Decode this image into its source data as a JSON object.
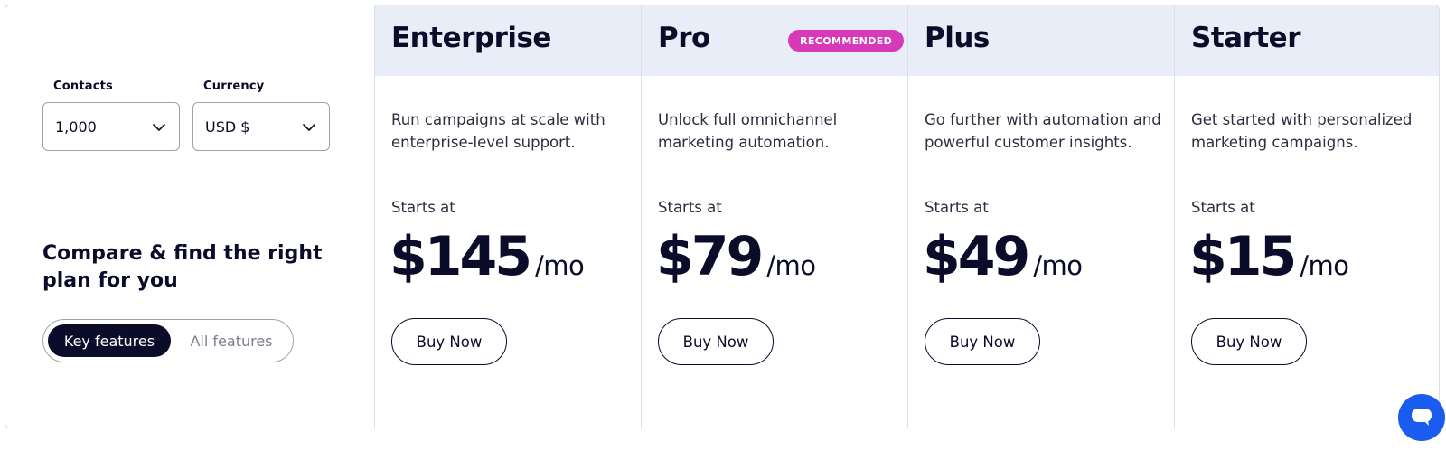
{
  "filters": {
    "contacts_label": "Contacts",
    "contacts_value": "1,000",
    "currency_label": "Currency",
    "currency_value": "USD $"
  },
  "compare": {
    "title": "Compare & find the right plan for you",
    "toggle_active": "Key features",
    "toggle_inactive": "All features"
  },
  "plans": [
    {
      "name": "Enterprise",
      "description": "Run campaigns at scale with enterprise-level support.",
      "starts_label": "Starts at",
      "price": "$145",
      "period": "/mo",
      "button": "Buy Now"
    },
    {
      "name": "Pro",
      "badge": "RECOMMENDED",
      "description": "Unlock full omnichannel marketing automation.",
      "starts_label": "Starts at",
      "price": "$79",
      "period": "/mo",
      "button": "Buy Now"
    },
    {
      "name": "Plus",
      "description": "Go further with automation and powerful customer insights.",
      "starts_label": "Starts at",
      "price": "$49",
      "period": "/mo",
      "button": "Buy Now"
    },
    {
      "name": "Starter",
      "description": "Get started with personalized marketing campaigns.",
      "starts_label": "Starts at",
      "price": "$15",
      "period": "/mo",
      "button": "Buy Now"
    }
  ],
  "icons": {
    "select_chevron": "chevron-down-icon",
    "chat": "chat-icon"
  },
  "colors": {
    "text": "#0b0c2a",
    "header_bg": "#e9edf7",
    "badge": "#d63ab8",
    "toggle_active_bg": "#0b0c2a",
    "chat_button": "#1b5cf0"
  }
}
